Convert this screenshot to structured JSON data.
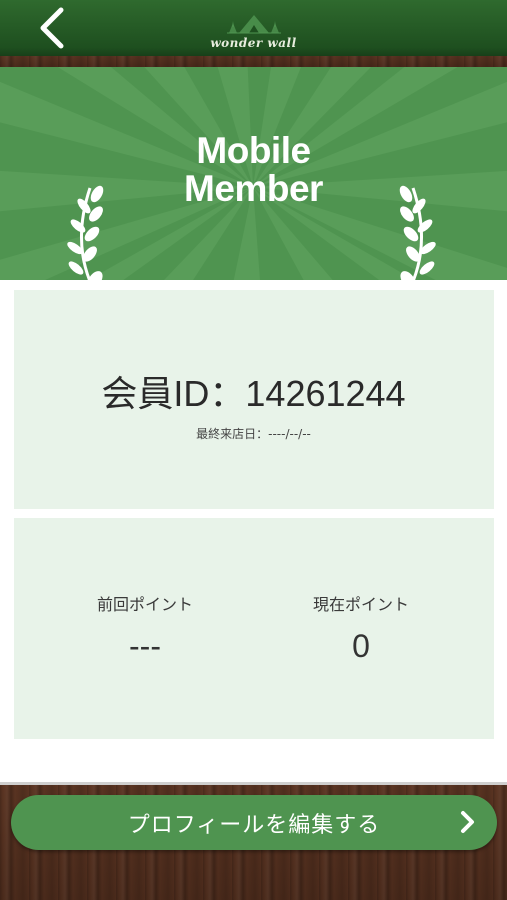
{
  "header": {
    "logo_text": "wonder wall",
    "back_icon": "chevron-left-icon"
  },
  "banner": {
    "title_line1": "Mobile",
    "title_line2": "Member"
  },
  "member": {
    "id_text": "会員ID：14261244",
    "last_visit": "最終来店日：----/--/--"
  },
  "points": {
    "previous_label": "前回ポイント",
    "previous_value": "---",
    "current_label": "現在ポイント",
    "current_value": "0"
  },
  "footer": {
    "edit_button_label": "プロフィールを編集する"
  },
  "colors": {
    "header_green": "#1e4f1f",
    "banner_green": "#4f9450",
    "card_bg": "#e8f3e9",
    "wood_brown": "#4a2a1b"
  }
}
